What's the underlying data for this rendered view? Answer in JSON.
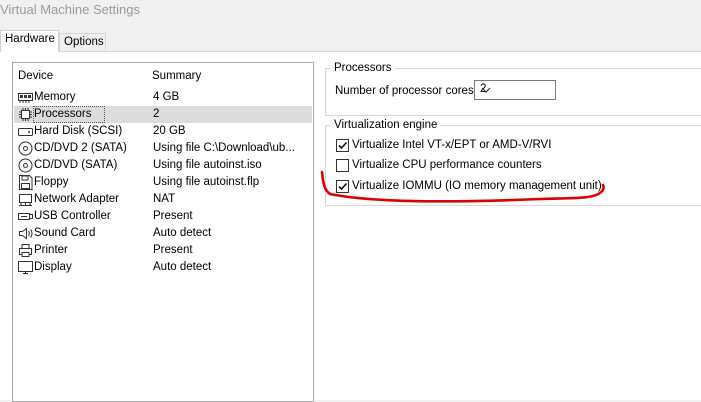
{
  "window": {
    "title": "Virtual Machine Settings"
  },
  "tabs": [
    {
      "label": "Hardware",
      "active": true
    },
    {
      "label": "Options",
      "active": false
    }
  ],
  "device_list": {
    "headers": {
      "device": "Device",
      "summary": "Summary"
    },
    "items": [
      {
        "device": "Memory",
        "summary": "4 GB",
        "icon": "memory-icon"
      },
      {
        "device": "Processors",
        "summary": "2",
        "icon": "processor-icon",
        "selected": true
      },
      {
        "device": "Hard Disk (SCSI)",
        "summary": "20 GB",
        "icon": "hard-disk-icon"
      },
      {
        "device": "CD/DVD 2 (SATA)",
        "summary": "Using file C:\\Download\\ub...",
        "icon": "cd-dvd-icon"
      },
      {
        "device": "CD/DVD (SATA)",
        "summary": "Using file autoinst.iso",
        "icon": "cd-dvd-icon"
      },
      {
        "device": "Floppy",
        "summary": "Using file autoinst.flp",
        "icon": "floppy-icon"
      },
      {
        "device": "Network Adapter",
        "summary": "NAT",
        "icon": "network-icon"
      },
      {
        "device": "USB Controller",
        "summary": "Present",
        "icon": "usb-icon"
      },
      {
        "device": "Sound Card",
        "summary": "Auto detect",
        "icon": "sound-icon"
      },
      {
        "device": "Printer",
        "summary": "Present",
        "icon": "printer-icon"
      },
      {
        "device": "Display",
        "summary": "Auto detect",
        "icon": "display-icon"
      }
    ]
  },
  "processors": {
    "group_label": "Processors",
    "cores_label": "Number of processor cores:",
    "cores_value": "2"
  },
  "virtualization": {
    "group_label": "Virtualization engine",
    "options": [
      {
        "label": "Virtualize Intel VT-x/EPT or AMD-V/RVI",
        "checked": true
      },
      {
        "label": "Virtualize CPU performance counters",
        "checked": false
      },
      {
        "label": "Virtualize IOMMU (IO memory management unit)",
        "checked": true
      }
    ]
  },
  "colors": {
    "annotation": "#e00000",
    "selection": "#dcdcdc"
  }
}
